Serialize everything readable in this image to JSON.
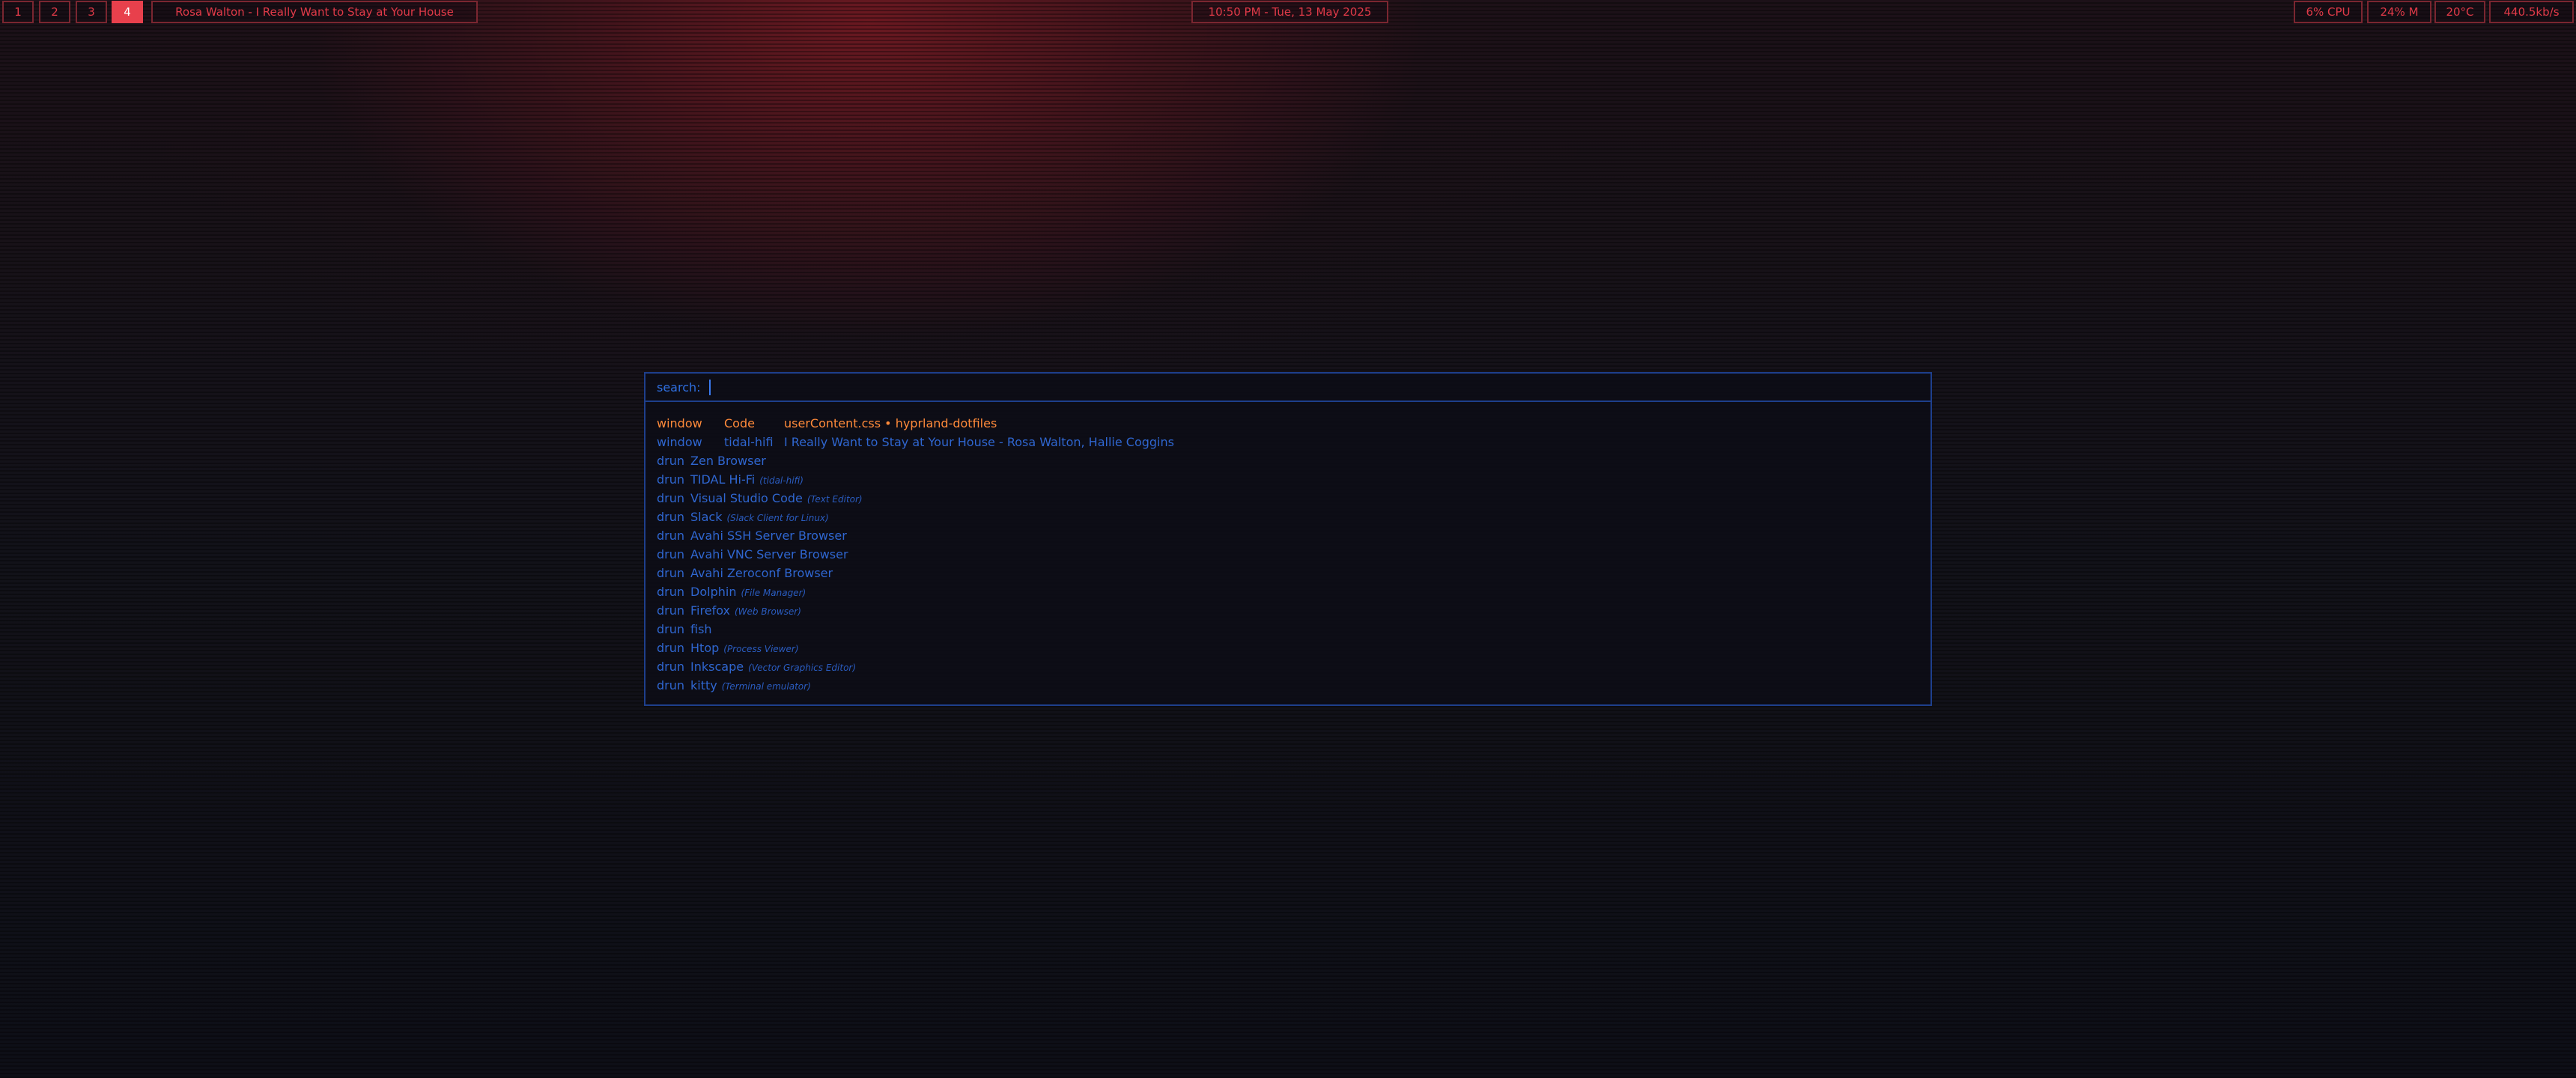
{
  "bar": {
    "workspaces": [
      {
        "label": "1",
        "active": false
      },
      {
        "label": "2",
        "active": false
      },
      {
        "label": "3",
        "active": false
      },
      {
        "label": "4",
        "active": true
      }
    ],
    "window_title": "Rosa Walton - I Really Want to Stay at Your House",
    "clock": "10:50 PM - Tue, 13 May 2025",
    "cpu": "6% CPU",
    "memory": "24% M",
    "temperature": "20°C",
    "network": "440.5kb/s"
  },
  "launcher": {
    "prompt": "search:",
    "query": "",
    "windows": [
      {
        "mode": "window",
        "class": "Code",
        "title": "userContent.css • hyprland-dotfiles",
        "selected": true
      },
      {
        "mode": "window",
        "class": "tidal-hifi",
        "title": "I Really Want to Stay at Your House - Rosa Walton, Hallie Coggins",
        "selected": false
      }
    ],
    "apps": [
      {
        "mode": "drun",
        "name": "Zen Browser",
        "desc": ""
      },
      {
        "mode": "drun",
        "name": "TIDAL Hi-Fi",
        "desc": "(tidal-hifi)"
      },
      {
        "mode": "drun",
        "name": "Visual Studio Code",
        "desc": "(Text Editor)"
      },
      {
        "mode": "drun",
        "name": "Slack",
        "desc": "(Slack Client for Linux)"
      },
      {
        "mode": "drun",
        "name": "Avahi SSH Server Browser",
        "desc": ""
      },
      {
        "mode": "drun",
        "name": "Avahi VNC Server Browser",
        "desc": ""
      },
      {
        "mode": "drun",
        "name": "Avahi Zeroconf Browser",
        "desc": ""
      },
      {
        "mode": "drun",
        "name": "Dolphin",
        "desc": "(File Manager)"
      },
      {
        "mode": "drun",
        "name": "Firefox",
        "desc": "(Web Browser)"
      },
      {
        "mode": "drun",
        "name": "fish",
        "desc": ""
      },
      {
        "mode": "drun",
        "name": "Htop",
        "desc": "(Process Viewer)"
      },
      {
        "mode": "drun",
        "name": "Inkscape",
        "desc": "(Vector Graphics Editor)"
      },
      {
        "mode": "drun",
        "name": "kitty",
        "desc": "(Terminal emulator)"
      }
    ]
  },
  "colors": {
    "bar_accent": "#e03a48",
    "bar_border": "#7a2630",
    "launcher_text": "#2f66d0",
    "launcher_border": "#1e3f8c",
    "selected_text": "#ff8a3a"
  }
}
